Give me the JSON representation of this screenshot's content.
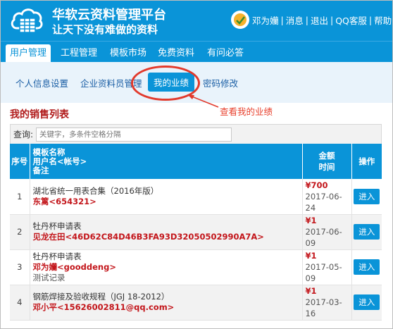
{
  "header": {
    "brand_title": "华软云资料管理平台",
    "slogan": "让天下没有难做的资料",
    "user_name": "邓为孏",
    "links": [
      "消息",
      "退出",
      "QQ客服",
      "帮助"
    ],
    "sep": "|"
  },
  "main_nav": [
    "用户管理",
    "工程管理",
    "模板市场",
    "免费资料",
    "有问必答"
  ],
  "sub_nav": [
    "个人信息设置",
    "企业资料员管理",
    "我的业绩",
    "密码修改"
  ],
  "annotation": "查看我的业绩",
  "section_title": "我的销售列表",
  "search": {
    "label": "查询:",
    "placeholder": "关键字，多条件空格分隔"
  },
  "table": {
    "headers": {
      "num": "序号",
      "name_lines": [
        "模板名称",
        "用户名<帐号>",
        "备注"
      ],
      "price_lines": [
        "金额",
        "时间"
      ],
      "op": "操作"
    },
    "rows": [
      {
        "num": "1",
        "template": "湖北省统一用表合集（2016年版）",
        "user": "东篱<654321>",
        "note": "",
        "amount": "¥700",
        "date": "2017-06-24",
        "button": "进入"
      },
      {
        "num": "2",
        "template": "牡丹杯申请表",
        "user": "见龙在田<46D62C84D46B3FA93D32050502990A7A>",
        "note": "",
        "amount": "¥1",
        "date": "2017-06-09",
        "button": "进入"
      },
      {
        "num": "3",
        "template": "牡丹杯申请表",
        "user": "邓为孏<gooddeng>",
        "note": "测试记录",
        "amount": "¥1",
        "date": "2017-05-09",
        "button": "进入"
      },
      {
        "num": "4",
        "template": "钢筋焊接及验收规程（JGJ 18-2012）",
        "user": "邓小平<15626002811@qq.com>",
        "note": "",
        "amount": "¥1",
        "date": "2017-03-16",
        "button": "进入"
      }
    ]
  },
  "colors": {
    "brand_blue": "#0a94d8",
    "accent_red": "#c3161b",
    "annotation_red": "#e23a2c"
  }
}
